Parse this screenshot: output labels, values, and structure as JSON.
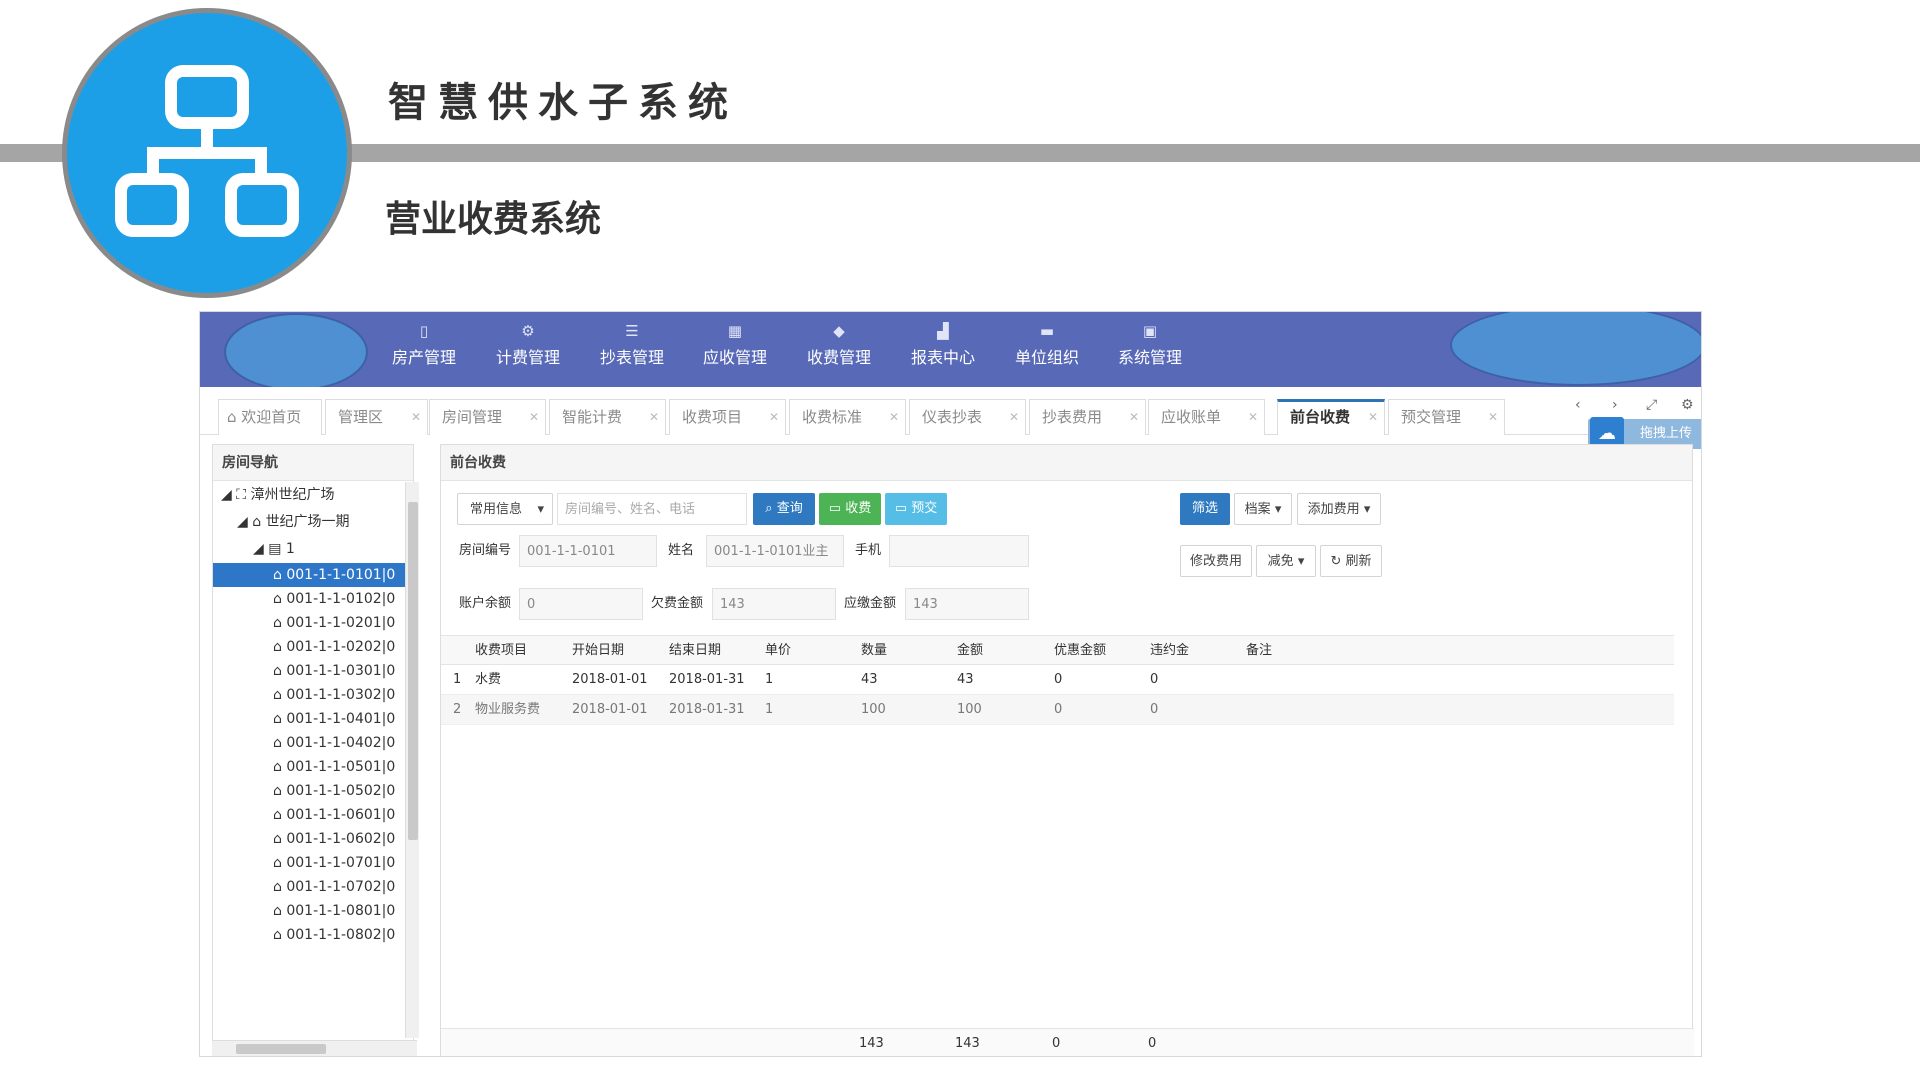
{
  "slide": {
    "system_title": "智慧供水子系统",
    "section_title": "营业收费系统"
  },
  "nav": {
    "items": [
      {
        "label": "房产管理",
        "icon": "building-icon"
      },
      {
        "label": "计费管理",
        "icon": "gears-icon"
      },
      {
        "label": "抄表管理",
        "icon": "list-icon"
      },
      {
        "label": "应收管理",
        "icon": "table-icon"
      },
      {
        "label": "收费管理",
        "icon": "tag-icon"
      },
      {
        "label": "报表中心",
        "icon": "chart-icon"
      },
      {
        "label": "单位组织",
        "icon": "org-icon"
      },
      {
        "label": "系统管理",
        "icon": "window-icon"
      }
    ]
  },
  "tabs": [
    {
      "label": "欢迎首页"
    },
    {
      "label": "管理区"
    },
    {
      "label": "房间管理"
    },
    {
      "label": "智能计费"
    },
    {
      "label": "收费项目"
    },
    {
      "label": "收费标准"
    },
    {
      "label": "仪表抄表"
    },
    {
      "label": "抄表费用"
    },
    {
      "label": "应收账单"
    },
    {
      "label": "前台收费"
    },
    {
      "label": "预交管理"
    }
  ],
  "upload_label": "拖拽上传",
  "tree": {
    "title": "房间导航",
    "root": "漳州世纪广场",
    "level1": "世纪广场一期",
    "level2": "1",
    "rooms": [
      "001-1-1-0101|0",
      "001-1-1-0102|0",
      "001-1-1-0201|0",
      "001-1-1-0202|0",
      "001-1-1-0301|0",
      "001-1-1-0302|0",
      "001-1-1-0401|0",
      "001-1-1-0402|0",
      "001-1-1-0501|0",
      "001-1-1-0502|0",
      "001-1-1-0601|0",
      "001-1-1-0602|0",
      "001-1-1-0701|0",
      "001-1-1-0702|0",
      "001-1-1-0801|0",
      "001-1-1-0802|0"
    ]
  },
  "main": {
    "title": "前台收费",
    "common_info": "常用信息",
    "search_placeholder": "房间编号、姓名、电话",
    "btn_query": "查询",
    "btn_charge": "收费",
    "btn_prepay": "预交",
    "btn_filter": "筛选",
    "btn_archive": "档案",
    "btn_add_fee": "添加费用",
    "btn_modify_fee": "修改费用",
    "btn_reduce": "减免",
    "btn_refresh": "刷新",
    "room_no_label": "房间编号",
    "room_no_value": "001-1-1-0101",
    "name_label": "姓名",
    "name_value": "001-1-1-0101业主",
    "phone_label": "手机",
    "phone_value": "",
    "balance_label": "账户余额",
    "balance_value": "0",
    "arrears_label": "欠费金额",
    "arrears_value": "143",
    "due_label": "应缴金额",
    "due_value": "143"
  },
  "grid": {
    "columns": [
      "收费项目",
      "开始日期",
      "结束日期",
      "单价",
      "数量",
      "金额",
      "优惠金额",
      "违约金",
      "备注"
    ],
    "rows": [
      {
        "no": "1",
        "item": "水费",
        "start": "2018-01-01",
        "end": "2018-01-31",
        "price": "1",
        "qty": "43",
        "amount": "43",
        "discount": "0",
        "penalty": "0",
        "remark": ""
      },
      {
        "no": "2",
        "item": "物业服务费",
        "start": "2018-01-01",
        "end": "2018-01-31",
        "price": "1",
        "qty": "100",
        "amount": "100",
        "discount": "0",
        "penalty": "0",
        "remark": ""
      }
    ],
    "footer": {
      "qty": "143",
      "amount": "143",
      "discount": "0",
      "penalty": "0"
    }
  }
}
